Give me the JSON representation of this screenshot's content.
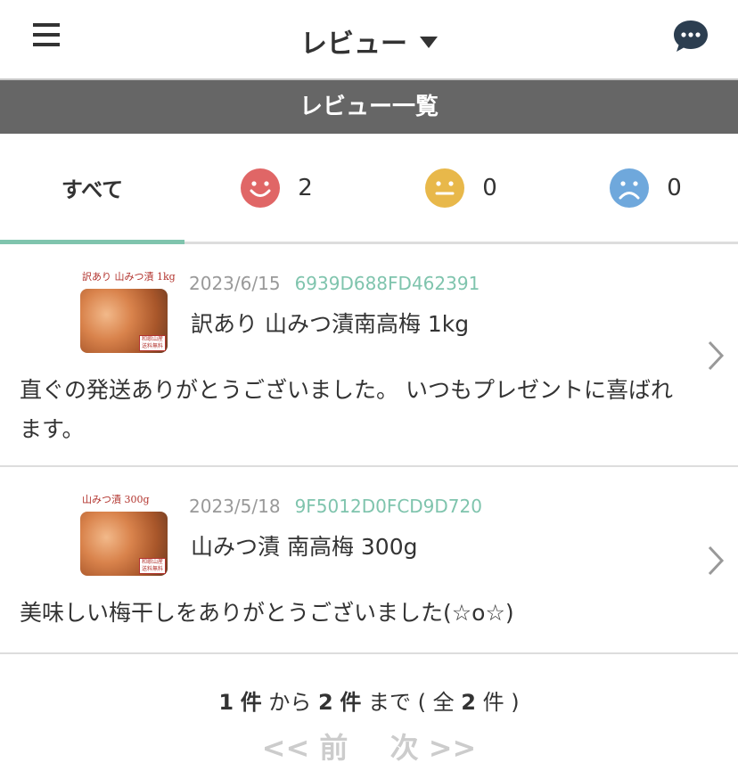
{
  "header": {
    "title": "レビュー",
    "menu_icon": "hamburger-menu-icon",
    "chat_icon": "chat-bubble-icon"
  },
  "section": {
    "title": "レビュー一覧"
  },
  "tabs": [
    {
      "label": "すべて",
      "active": true
    },
    {
      "icon": "smile-face-icon",
      "color": "#e06666",
      "count": "2"
    },
    {
      "icon": "neutral-face-icon",
      "color": "#e8b84a",
      "count": "0"
    },
    {
      "icon": "sad-face-icon",
      "color": "#6fa8dc",
      "count": "0"
    }
  ],
  "reviews": [
    {
      "thumb_label": "訳あり 山みつ漬 1kg",
      "thumb_badge": "和歌山産 送料無料",
      "date": "2023/6/15",
      "order_id": "6939D688FD462391",
      "product": "訳あり 山みつ漬南高梅 1kg",
      "comment": "直ぐの発送ありがとうございました。 いつもプレゼントに喜ばれます。"
    },
    {
      "thumb_label": "山みつ漬 300g",
      "thumb_badge": "和歌山産 送料無料",
      "date": "2023/5/18",
      "order_id": "9F5012D0FCD9D720",
      "product": "山みつ漬 南高梅 300g",
      "comment": "美味しい梅干しをありがとうございました(☆o☆)"
    }
  ],
  "pager": {
    "from": "1",
    "to": "2",
    "total": "2",
    "unit": "件",
    "from_word": "から",
    "to_word": "まで",
    "total_prefix": "( 全",
    "total_suffix": "件 )",
    "prev": "<< 前",
    "next": "次 >>"
  },
  "colors": {
    "accent": "#7fc4ad",
    "section_bar": "#666666",
    "smile": "#e06666",
    "neutral": "#e8b84a",
    "sad": "#6fa8dc"
  }
}
